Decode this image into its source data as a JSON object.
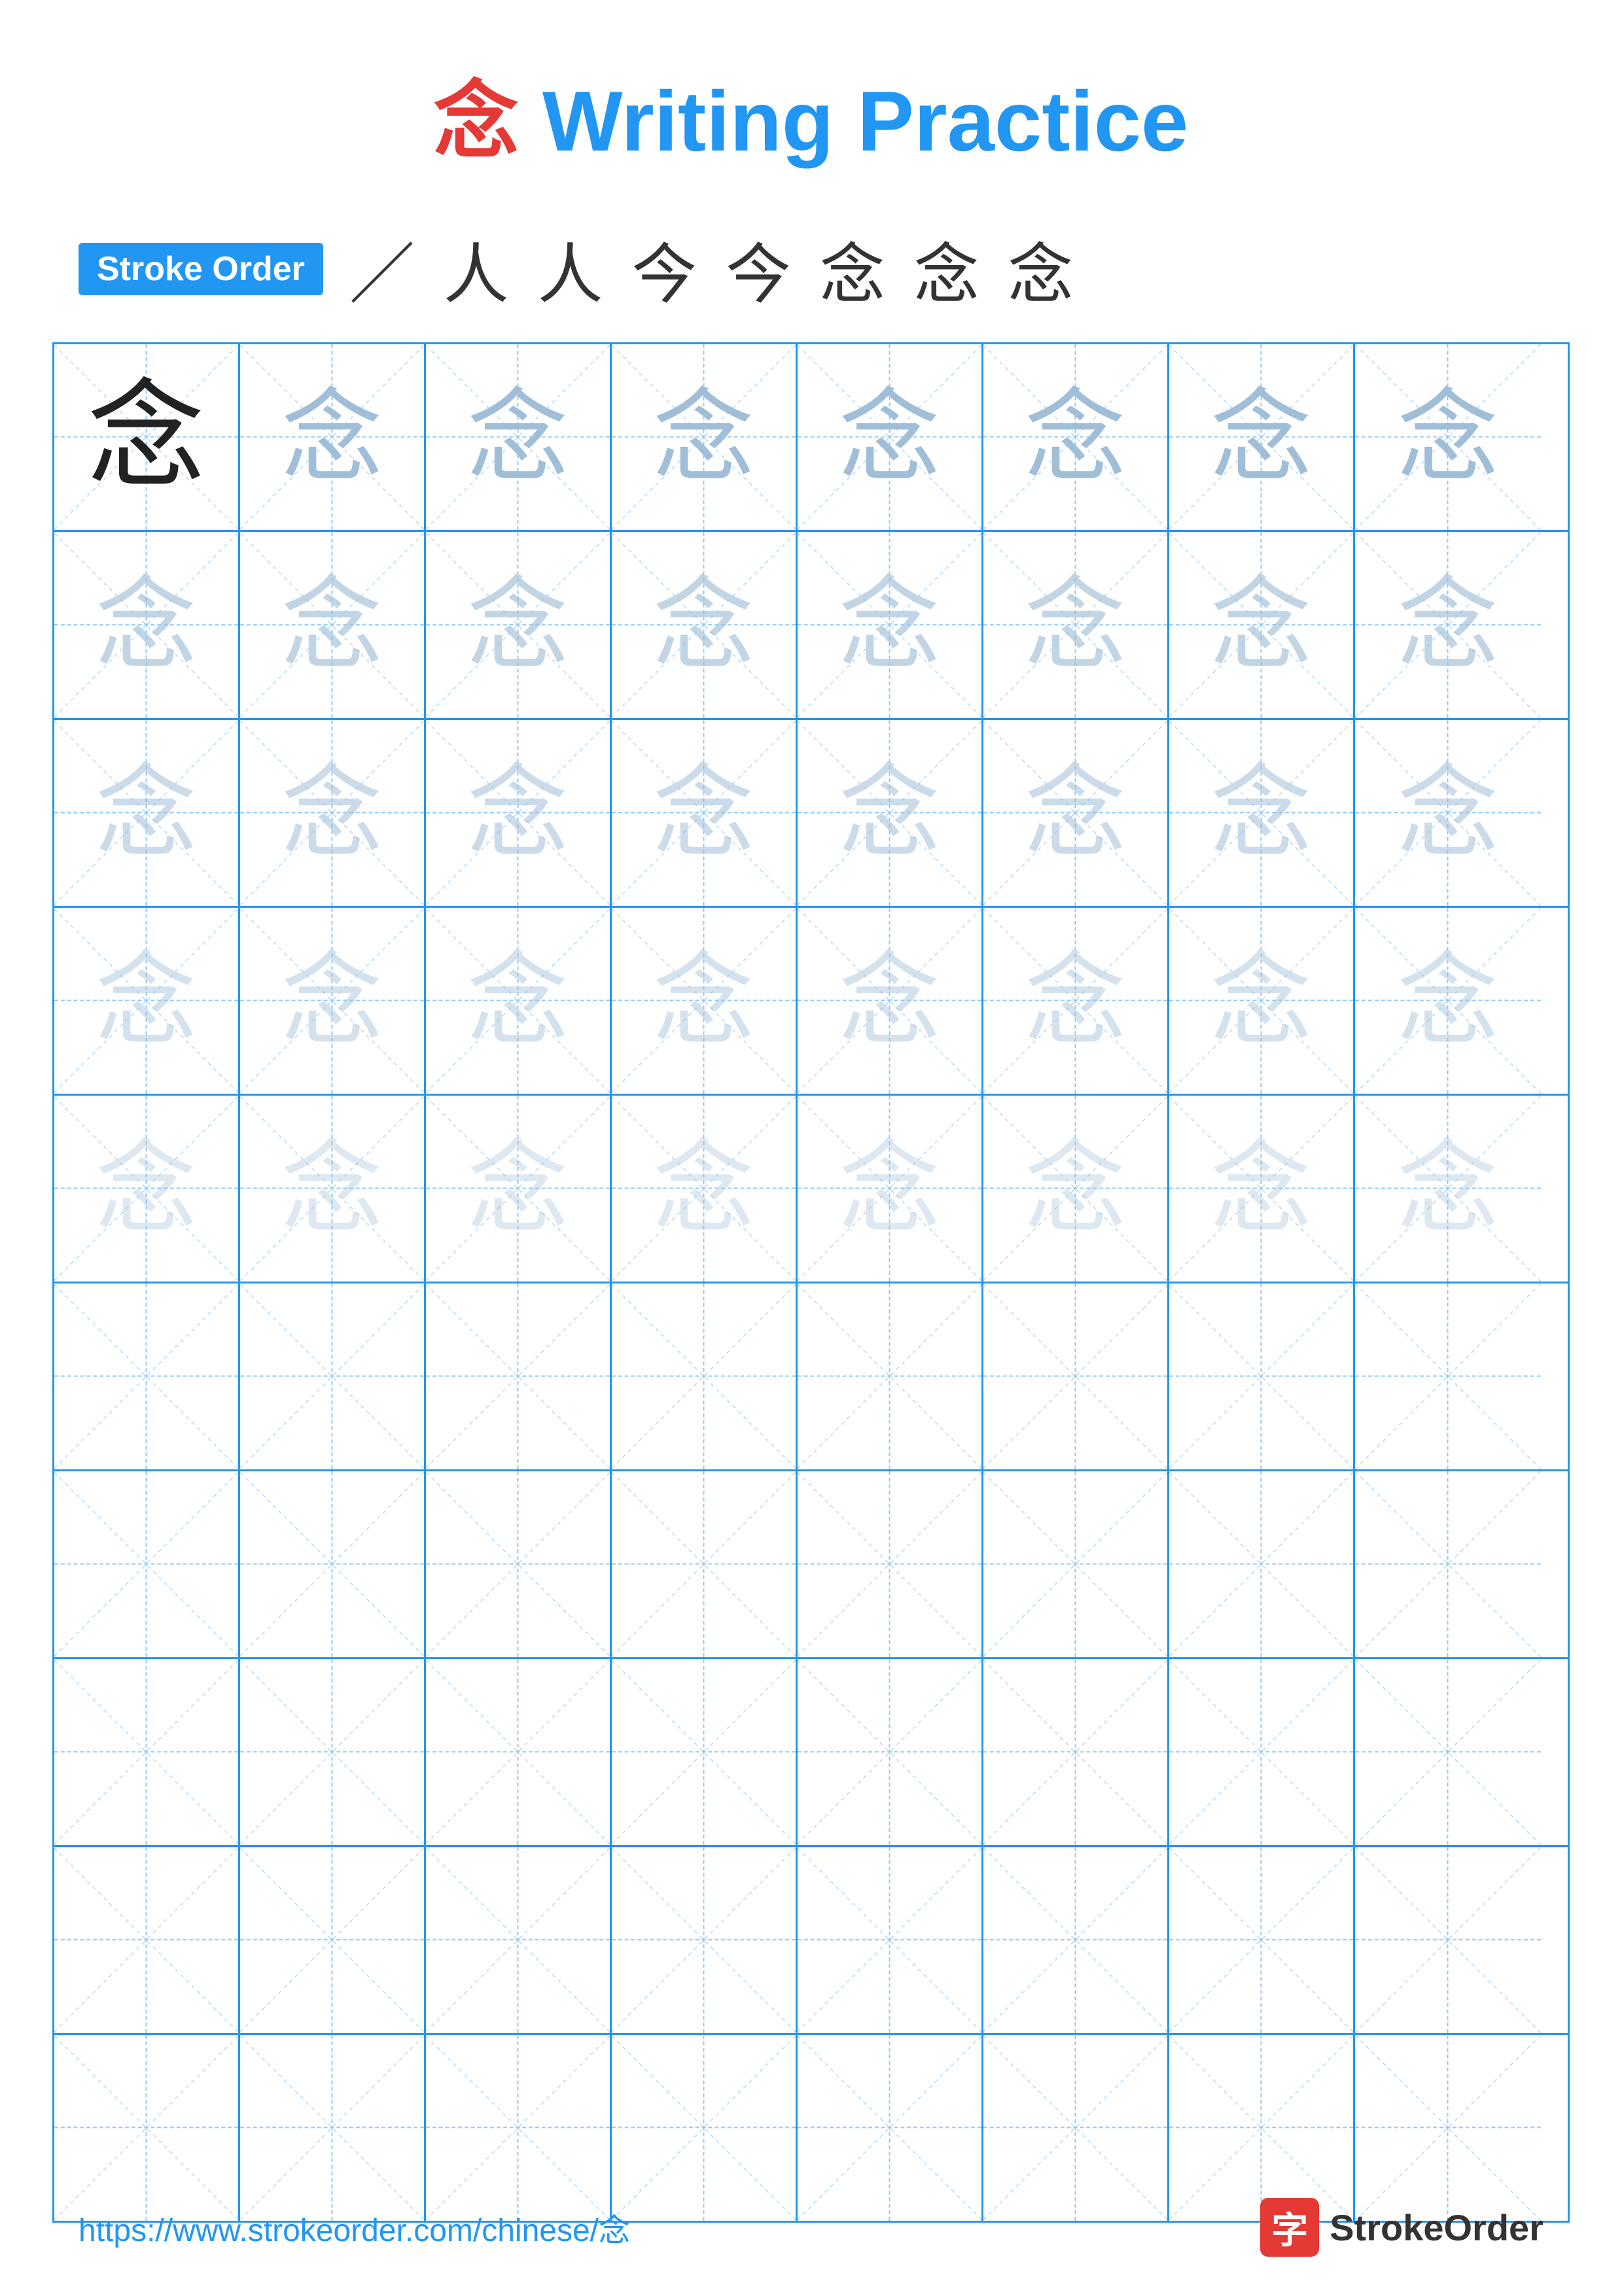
{
  "title": {
    "char": "念",
    "text": " Writing Practice",
    "full": "念 Writing Practice"
  },
  "stroke_order": {
    "badge_label": "Stroke Order",
    "strokes": "／ 人 人 今 今 念 念 念"
  },
  "grid": {
    "rows": 10,
    "cols": 8,
    "char": "念",
    "practice_rows_with_char": 5,
    "empty_rows": 5
  },
  "footer": {
    "url": "https://www.strokeorder.com/chinese/念",
    "logo_char": "字",
    "logo_text": "StrokeOrder"
  }
}
